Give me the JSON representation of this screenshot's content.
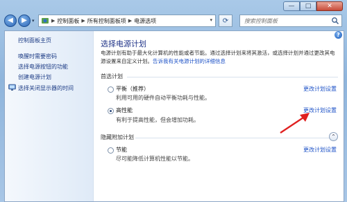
{
  "window": {
    "caption_buttons": {
      "minimize": "—",
      "maximize": "□",
      "close": "✕"
    }
  },
  "nav": {
    "back_glyph": "◀",
    "forward_glyph": "▶",
    "dropdown_glyph": "▾",
    "address_segments": [
      "控制面板",
      "所有控制面板项",
      "电源选项"
    ],
    "address_separator": "▶",
    "refresh_glyph": "⟳",
    "search_placeholder": "搜索控制面板"
  },
  "sidebar": {
    "home": "控制面板主页",
    "items": [
      "唤醒时需要密码",
      "选择电源按钮的功能",
      "创建电源计划",
      "选择关闭显示器的时间"
    ]
  },
  "main": {
    "help_glyph": "?",
    "title": "选择电源计划",
    "description_line1": "电源计划有助于最大化计算机的性能或者节能。通过选择计划来将其激活，或选择计划并通过更改其电",
    "description_line2_prefix": "源设置来自定义计划。",
    "description_link": "告诉我有关电源计划的详细信息",
    "preferred_label": "首选计划",
    "hidden_label": "隐藏附加计划",
    "collapse_glyph": "⌃",
    "plans": [
      {
        "name": "平衡（推荐）",
        "desc": "利用可用的硬件自动平衡功耗与性能。",
        "change": "更改计划设置",
        "selected": false
      },
      {
        "name": "高性能",
        "desc": "有利于提高性能，但会增加功耗。",
        "change": "更改计划设置",
        "selected": true
      },
      {
        "name": "节能",
        "desc": "尽可能降低计算机性能以节能。",
        "change": "更改计划设置",
        "selected": false
      }
    ]
  },
  "colors": {
    "link": "#1d52c7",
    "title": "#1e3287",
    "annotation_arrow": "#e02020"
  }
}
